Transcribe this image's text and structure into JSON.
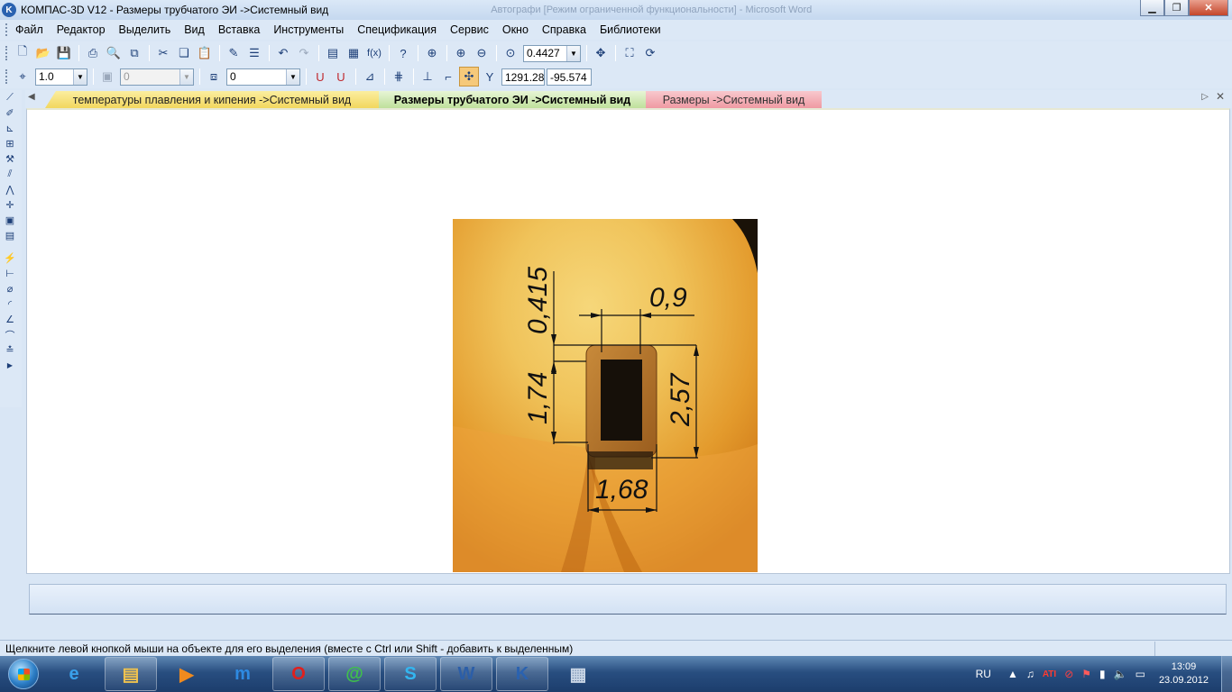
{
  "window": {
    "title": "КОМПАС-3D V12 - Размеры трубчатого ЭИ ->Системный вид",
    "background_title": "Автографи [Режим ограниченной функциональности] - Microsoft Word",
    "app_icon": "kompas-logo-icon"
  },
  "menu": [
    "Файл",
    "Редактор",
    "Выделить",
    "Вид",
    "Вставка",
    "Инструменты",
    "Спецификация",
    "Сервис",
    "Окно",
    "Справка",
    "Библиотеки"
  ],
  "toolbar_main": {
    "zoom_value": "0.4427"
  },
  "toolbar_current": {
    "step_value": "1.0",
    "layer_value": "0",
    "style_value": "0",
    "coord_x": "1291.28",
    "coord_y": "-95.574"
  },
  "tabs": [
    {
      "label": "температуры плавления и кипения ->Системный вид"
    },
    {
      "label": "Размеры трубчатого ЭИ ->Системный вид"
    },
    {
      "label": "Размеры ->Системный вид"
    }
  ],
  "drawing": {
    "dimensions": [
      "0,415",
      "0,9",
      "1,74",
      "2,57",
      "1,68"
    ]
  },
  "status": {
    "message": "Щелкните левой кнопкой мыши на объекте для его выделения (вместе с Ctrl или Shift - добавить к выделенным)"
  },
  "taskbar": {
    "language": "RU",
    "time": "13:09",
    "date": "23.09.2012",
    "apps": [
      "explorer-icon",
      "ie-icon",
      "media-player-icon",
      "maxthon-icon",
      "opera-icon",
      "mail-agent-icon",
      "skype-icon",
      "word-icon",
      "kompas-icon",
      "calculator-icon"
    ]
  }
}
